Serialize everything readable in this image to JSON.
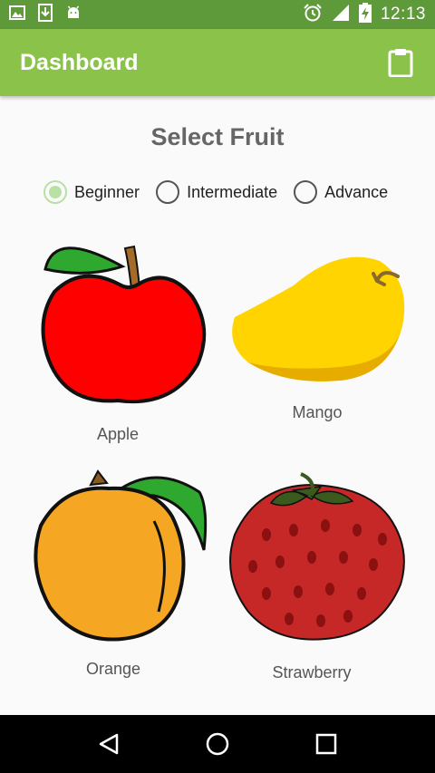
{
  "status_bar": {
    "time": "12:13",
    "left_icons": [
      "image-icon",
      "download-icon",
      "android-icon"
    ],
    "right_icons": [
      "alarm-icon",
      "signal-icon",
      "battery-charging-icon"
    ]
  },
  "app_bar": {
    "title": "Dashboard",
    "action_icon": "clipboard-icon",
    "color": "#8bc34a"
  },
  "heading": "Select Fruit",
  "levels": {
    "selected": "Beginner",
    "options": [
      {
        "label": "Beginner",
        "checked": true
      },
      {
        "label": "Intermediate",
        "checked": false
      },
      {
        "label": "Advance",
        "checked": false
      }
    ]
  },
  "fruits": [
    {
      "name": "Apple",
      "icon": "apple-icon"
    },
    {
      "name": "Mango",
      "icon": "mango-icon"
    },
    {
      "name": "Orange",
      "icon": "orange-icon"
    },
    {
      "name": "Strawberry",
      "icon": "strawberry-icon"
    }
  ],
  "nav_bar": {
    "buttons": [
      "back-icon",
      "home-icon",
      "recents-icon"
    ]
  }
}
